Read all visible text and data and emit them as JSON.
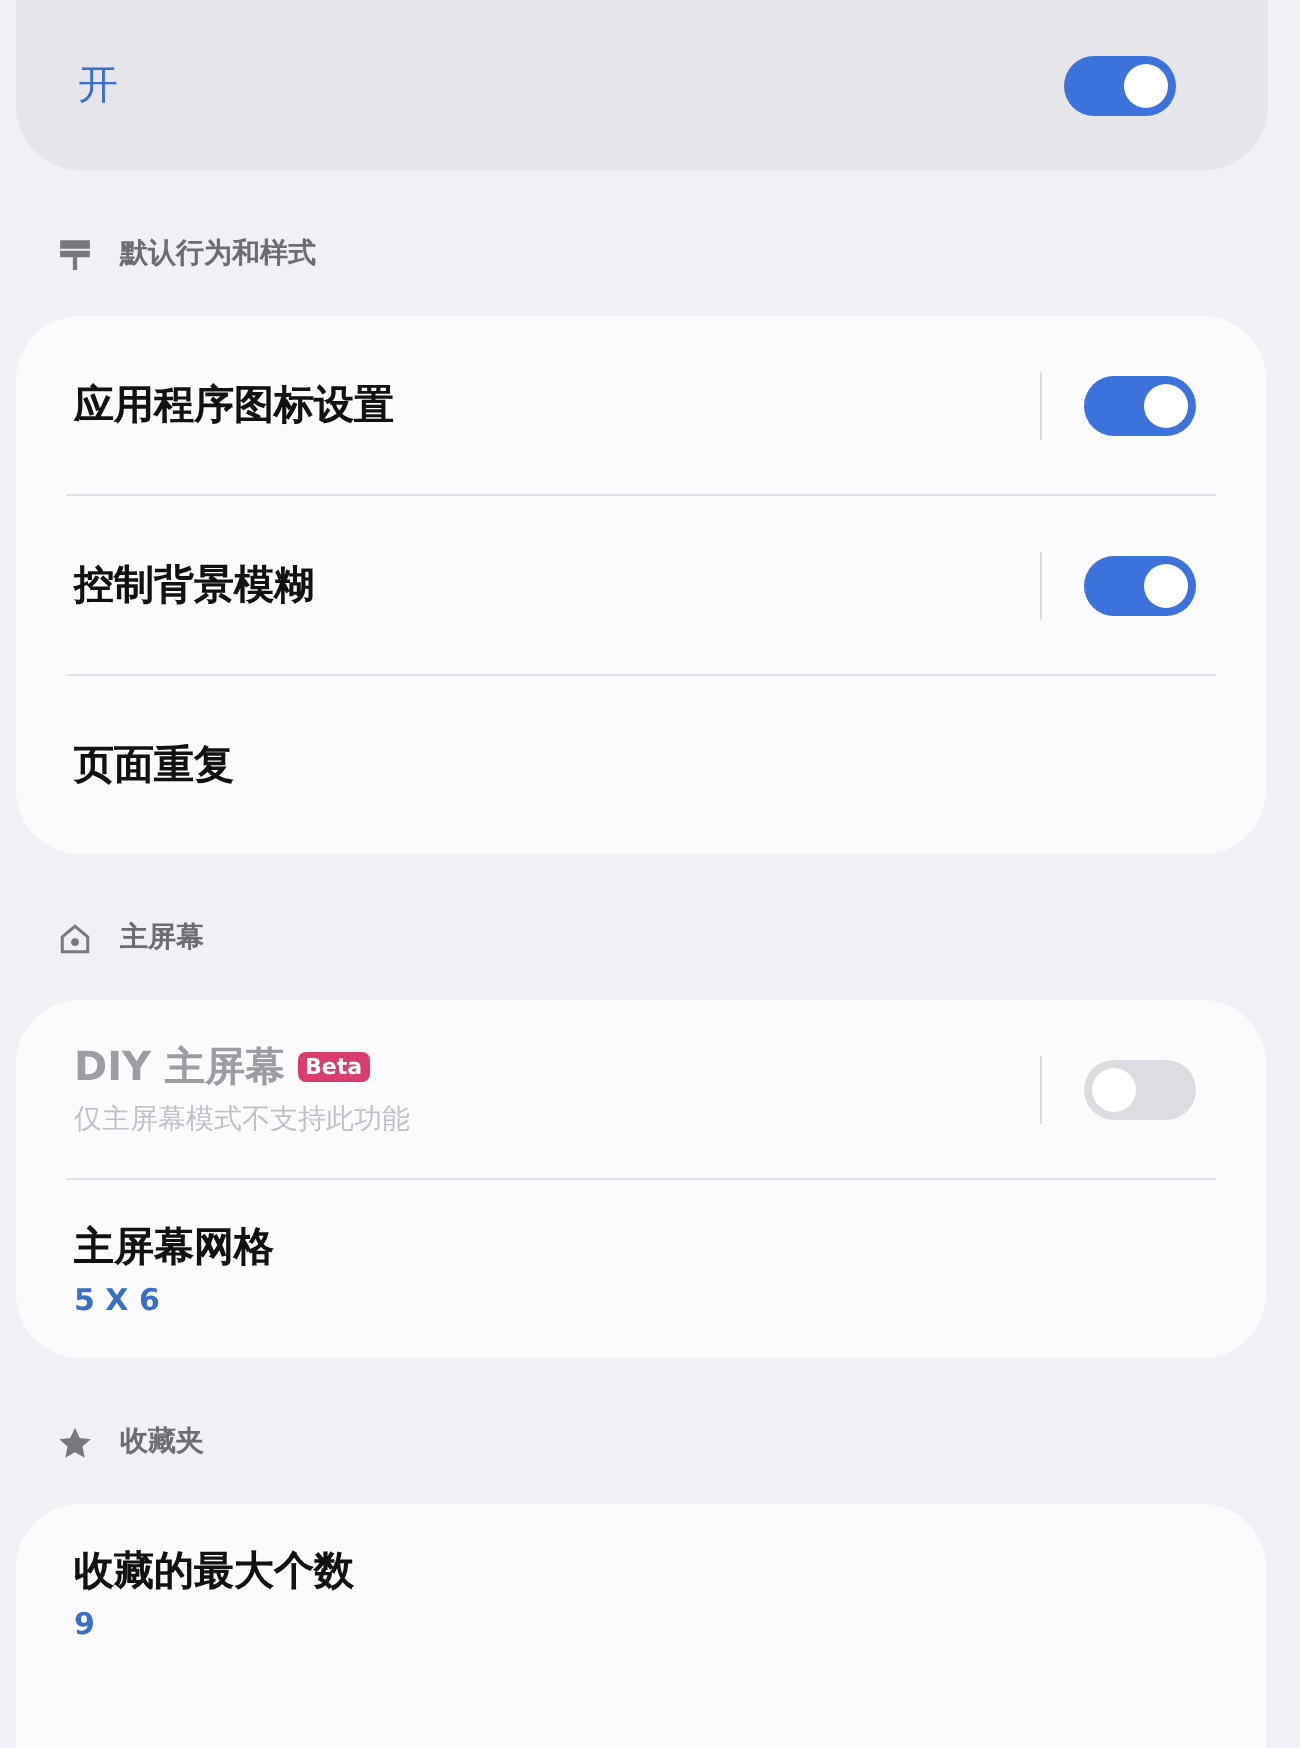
{
  "master": {
    "label": "开",
    "on": true
  },
  "sections": [
    {
      "title": "默认行为和样式",
      "rows": [
        {
          "kind": "switch",
          "title": "应用程序图标设置",
          "on": true,
          "disabled": false
        },
        {
          "kind": "switch",
          "title": "控制背景模糊",
          "on": true,
          "disabled": false
        },
        {
          "kind": "plain",
          "title": "页面重复"
        }
      ]
    },
    {
      "title": "主屏幕",
      "rows": [
        {
          "kind": "switch",
          "title": "DIY 主屏幕",
          "badge": "Beta",
          "subtitle": "仅主屏幕模式不支持此功能",
          "on": false,
          "disabled": true
        },
        {
          "kind": "value",
          "title": "主屏幕网格",
          "value": "5 X 6"
        }
      ]
    },
    {
      "title": "收藏夹",
      "rows": [
        {
          "kind": "value",
          "title": "收藏的最大个数",
          "value": "9"
        }
      ]
    }
  ]
}
